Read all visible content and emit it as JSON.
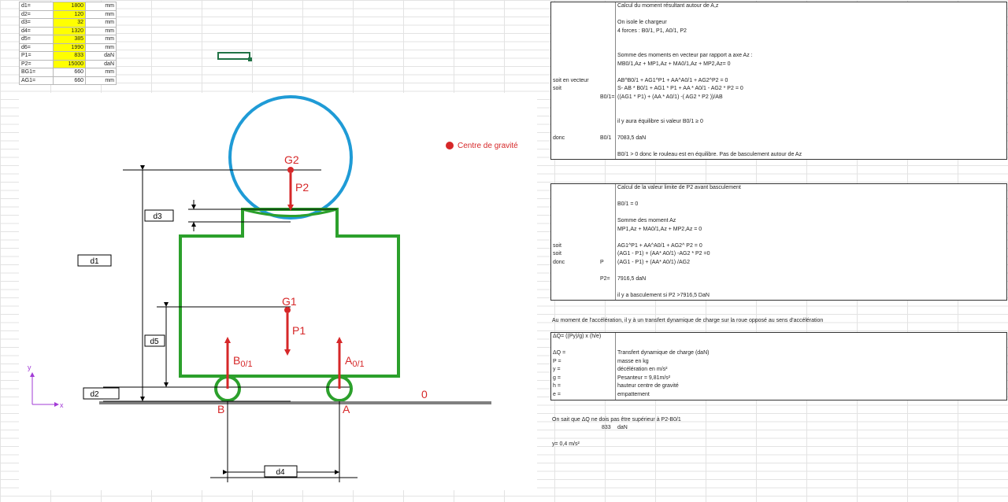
{
  "params": [
    {
      "name": "d1=",
      "value": "1800",
      "unit": "mm",
      "highlight": true
    },
    {
      "name": "d2=",
      "value": "120",
      "unit": "mm",
      "highlight": true
    },
    {
      "name": "d3=",
      "value": "32",
      "unit": "mm",
      "highlight": true
    },
    {
      "name": "d4=",
      "value": "1320",
      "unit": "mm",
      "highlight": true
    },
    {
      "name": "d5=",
      "value": "385",
      "unit": "mm",
      "highlight": true
    },
    {
      "name": "d6=",
      "value": "1990",
      "unit": "mm",
      "highlight": true
    },
    {
      "name": "P1=",
      "value": "833",
      "unit": "daN",
      "highlight": true
    },
    {
      "name": "P2=",
      "value": "15000",
      "unit": "daN",
      "highlight": true
    },
    {
      "name": "BG1=",
      "value": "660",
      "unit": "mm",
      "highlight": false
    },
    {
      "name": "AG1=",
      "value": "660",
      "unit": "mm",
      "highlight": false
    }
  ],
  "diagram": {
    "legend": "Centre de gravité",
    "labels": {
      "g2": "G2",
      "p2": "P2",
      "g1": "G1",
      "p1": "P1",
      "b": "B",
      "a": "A",
      "zero": "0",
      "b01_main": "B",
      "b01_sub": "0/1",
      "a01_main": "A",
      "a01_sub": "0/1",
      "d1": "d1",
      "d2": "d2",
      "d3": "d3",
      "d4": "d4",
      "d5": "d5",
      "axis_y": "y",
      "axis_x": "x"
    },
    "colors": {
      "roller": "#1f9bd6",
      "body": "#2ca02c",
      "force": "#d62728",
      "ground": "#808080",
      "dims": "#000000"
    }
  },
  "panel1": {
    "rows": [
      {
        "a": "",
        "b": "",
        "c": "Calcul du moment résultant autour de A,z"
      },
      {
        "a": "",
        "b": "",
        "c": ""
      },
      {
        "a": "",
        "b": "",
        "c": "On isole le chargeur"
      },
      {
        "a": "",
        "b": "",
        "c": "4 forces : B0/1, P1, A0/1, P2"
      },
      {
        "a": "",
        "b": "",
        "c": ""
      },
      {
        "a": "",
        "b": "",
        "c": ""
      },
      {
        "a": "",
        "b": "",
        "c": "Somme des moments en vecteur par rapport a axe Az :"
      },
      {
        "a": "",
        "b": "",
        "c": "MB0/1,Az + MP1,Az + MA0/1,Az + MP2,Az= 0"
      },
      {
        "a": "",
        "b": "",
        "c": ""
      },
      {
        "a": "soit en vecteur",
        "b": "",
        "c": "AB^B0/1 + AG1^P1 + AA^A0/1 + AG2^P2 = 0"
      },
      {
        "a": "soit",
        "b": "",
        "c": "S- AB * B0/1 + AG1 * P1 + AA * A0/1  - AG2 * P2 = 0"
      },
      {
        "a": "",
        "b": "B0/1=",
        "c": "((AG1 * P1) + (AA * A0/1)  -( AG2 * P2 ))/AB"
      },
      {
        "a": "",
        "b": "",
        "c": ""
      },
      {
        "a": "",
        "b": "",
        "c": ""
      },
      {
        "a": "",
        "b": "",
        "c": "il y aura équilibre si valeur B0/1 ≥ 0"
      },
      {
        "a": "",
        "b": "",
        "c": ""
      },
      {
        "a": "donc",
        "b": "B0/1",
        "c": "7083,5   daN"
      },
      {
        "a": "",
        "b": "",
        "c": ""
      },
      {
        "a": "",
        "b": "",
        "c": "B0/1 > 0 donc le rouleau est en équilibre. Pas de basculement autour de Az"
      }
    ]
  },
  "panel2": {
    "rows": [
      {
        "a": "",
        "b": "",
        "c": "Calcul de la valeur limite de P2 avant basculement"
      },
      {
        "a": "",
        "b": "",
        "c": ""
      },
      {
        "a": "",
        "b": "",
        "c": "B0/1 = 0"
      },
      {
        "a": "",
        "b": "",
        "c": ""
      },
      {
        "a": "",
        "b": "",
        "c": "Somme des moment Az"
      },
      {
        "a": "",
        "b": "",
        "c": "MP1,Az + MA0/1,Az + MP2,Az = 0"
      },
      {
        "a": "",
        "b": "",
        "c": ""
      },
      {
        "a": "soit",
        "b": "",
        "c": "AG1^P1 + AA^A0/1 + AG2^ P2 = 0"
      },
      {
        "a": "soit",
        "b": "",
        "c": "(AG1 - P1) + (AA* A0/1) -AG2 * P2 =0"
      },
      {
        "a": "donc",
        "b": "P",
        "c": "(AG1 - P1) + (AA* A0/1) /AG2"
      },
      {
        "a": "",
        "b": "",
        "c": ""
      },
      {
        "a": "",
        "b": "P2=",
        "c": "7916,5   daN"
      },
      {
        "a": "",
        "b": "",
        "c": ""
      },
      {
        "a": "",
        "b": "",
        "c": "il y a basculement si P2 >7916,5 DaN"
      }
    ]
  },
  "transfer_title": "Au moment de l'accélération, il y à un transfert dynamique de charge sur la roue opposé au sens d'accélération",
  "panel3": {
    "rows": [
      {
        "a": "ΔQ= ((Py)/g) x (h/e)",
        "b": "",
        "c": ""
      },
      {
        "a": "",
        "b": "",
        "c": ""
      },
      {
        "a": "ΔQ =",
        "b": "",
        "c": "Transfert dynamique de charge (daN)"
      },
      {
        "a": "P =",
        "b": "",
        "c": "masse en kg"
      },
      {
        "a": "y =",
        "b": "",
        "c": "décélération en m/s²"
      },
      {
        "a": "g =",
        "b": "",
        "c": "Pesanteur  = 9,81m/s²"
      },
      {
        "a": "h =",
        "b": "",
        "c": "hauteur centre de gravité"
      },
      {
        "a": "e =",
        "b": "",
        "c": "empattement"
      }
    ]
  },
  "bottom": {
    "line1": "On sait que ΔQ ne dois pas être supérieur à  P2-B0/1",
    "value": "833",
    "unit": "daN",
    "line3": "y= 0,4 m/s²"
  }
}
